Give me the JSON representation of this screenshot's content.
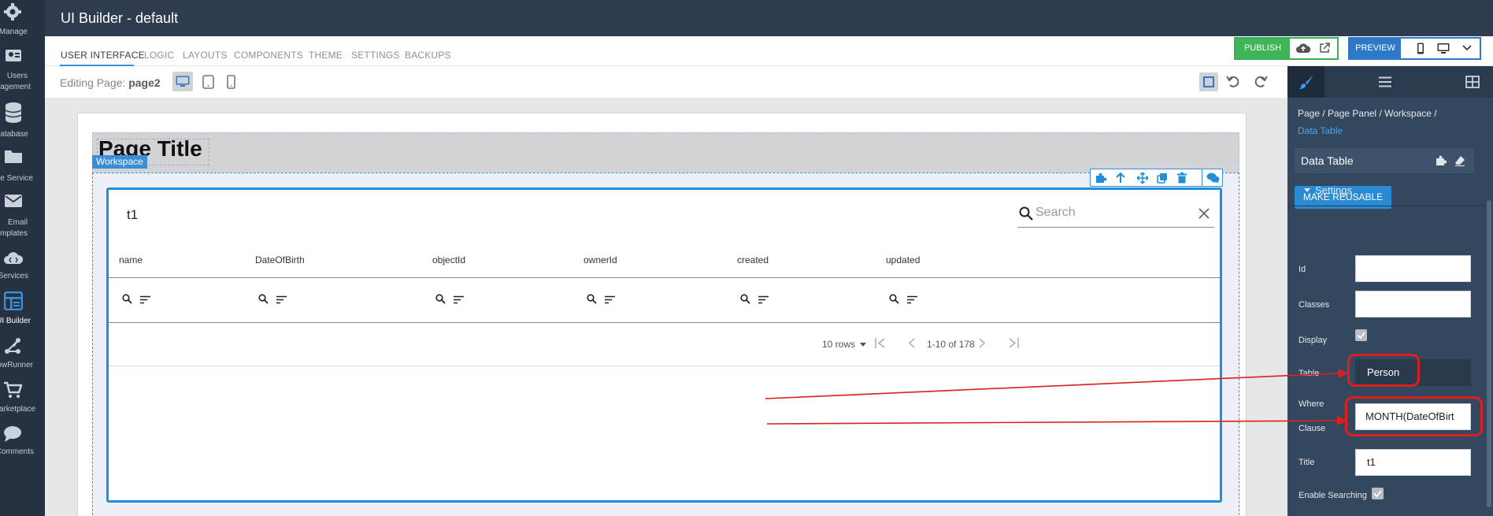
{
  "app": {
    "title": "UI Builder - default"
  },
  "nav": [
    {
      "label": "Manage",
      "icon": "gear-icon"
    },
    {
      "label": "Users",
      "label2": "Management",
      "icon": "users-icon"
    },
    {
      "label": "Database",
      "icon": "database-icon"
    },
    {
      "label": "File Service",
      "icon": "folder-icon"
    },
    {
      "label": "Email",
      "label2": "Templates",
      "icon": "envelope-icon"
    },
    {
      "label": "API Services",
      "icon": "cloud-code-icon"
    },
    {
      "label": "UI Builder",
      "icon": "layout-icon",
      "active": true
    },
    {
      "label": "FlowRunner",
      "icon": "flow-icon"
    },
    {
      "label": "Marketplace",
      "icon": "cart-icon"
    },
    {
      "label": "Comments",
      "icon": "comment-icon"
    }
  ],
  "tabs": [
    "USER INTERFACE",
    "LOGIC",
    "LAYOUTS",
    "COMPONENTS",
    "THEME",
    "SETTINGS",
    "BACKUPS"
  ],
  "publish": {
    "label": "PUBLISH"
  },
  "preview": {
    "label": "PREVIEW"
  },
  "editing": {
    "prefix": "Editing Page:",
    "page": "page2"
  },
  "canvas": {
    "page_title": "Page Title",
    "workspace_label": "Workspace",
    "table": {
      "title": "t1",
      "search_placeholder": "Search",
      "columns": [
        "name",
        "DateOfBirth",
        "objectId",
        "ownerId",
        "created",
        "updated"
      ],
      "rows_label": "10 rows",
      "range": "1-10 of 178"
    }
  },
  "panel": {
    "breadcrumb": [
      "Page",
      "Page Panel",
      "Workspace"
    ],
    "breadcrumb_current": "Data Table",
    "component": "Data Table",
    "make_reusable": "MAKE REUSABLE",
    "section": "Settings",
    "fields": {
      "id_label": "Id",
      "id_value": "",
      "classes_label": "Classes",
      "classes_value": "",
      "display_label": "Display",
      "display_checked": true,
      "table_label": "Table",
      "table_value": "Person",
      "where_label": "Where",
      "where_label2": "Clause",
      "where_value": "MONTH(DateOfBirt",
      "title_label": "Title",
      "title_value": "t1",
      "searching_label": "Enable Searching",
      "searching_checked": true
    }
  },
  "colors": {
    "accent": "#1f8fdd",
    "publish": "#3fb559",
    "annotation": "#e01e1e",
    "nav_bg": "#263241"
  }
}
